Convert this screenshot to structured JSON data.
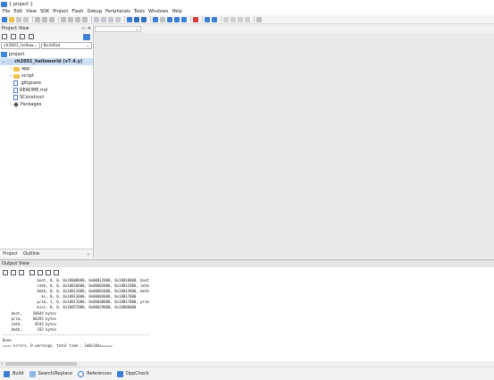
{
  "window": {
    "title": "{ project }"
  },
  "menubar": [
    "File",
    "Edit",
    "View",
    "SDK",
    "Project",
    "Flash",
    "Debug",
    "Peripherals",
    "Tools",
    "Windows",
    "Help"
  ],
  "colors": {
    "accent": "#3f83d6",
    "folder": "#f0c24a",
    "selection": "#cce0f7"
  },
  "project_view": {
    "title": "Project View",
    "header_controls": [
      "pin-icon",
      "close-icon"
    ],
    "toolbar_icons": [
      "navigate-icon",
      "home-icon",
      "settings-icon",
      "target-icon",
      "link-icon"
    ],
    "target_combo": "ch2601_hellow",
    "build_combo": "BuildSet",
    "tree": [
      {
        "label": "project",
        "icon": "project-icon",
        "indent": 0,
        "arrow": ""
      },
      {
        "label": "ch2601_helloworld (v7.4.y)",
        "icon": "folder-icon",
        "indent": 1,
        "arrow": "⌄",
        "selected": true
      },
      {
        "label": "app",
        "icon": "folder-icon",
        "indent": 2,
        "arrow": "›"
      },
      {
        "label": "script",
        "icon": "folder-icon",
        "indent": 2,
        "arrow": "›"
      },
      {
        "label": ".gitignore",
        "icon": "file-icon",
        "indent": 2,
        "arrow": ""
      },
      {
        "label": "README.md",
        "icon": "file-icon",
        "indent": 2,
        "arrow": ""
      },
      {
        "label": "SConstruct",
        "icon": "file-icon",
        "indent": 2,
        "arrow": ""
      },
      {
        "label": "Packages",
        "icon": "package-icon",
        "indent": 2,
        "arrow": "›"
      }
    ],
    "bottom_tabs": [
      "Project",
      "Outline"
    ]
  },
  "output_view": {
    "title": "Output View",
    "console_lines": [
      "                boot, 0, 0, 0x18000000, 0x00012000, 0x18010000, boot",
      "                imtb, 0, 0, 0x18010000, 0x00002000, 0x18012000, imtb",
      "                bmtb, 0, 0, 0x18012000, 0x00001000, 0x18013000, bmtb",
      "                  kv, 0, 0, 0x18013000, 0x00004000, 0x18017000",
      "                prim, 1, 0, 0x18017000, 0x00040000, 0x18057000, prim",
      "                misc, 0, 0, 0x18057000, 0x00029000, 0x18080000",
      "    boot,     58644 bytes",
      "    prim,     66392 bytes",
      "    imtb,      8192 bytes",
      "    bmtb,       192 bytes",
      "--------------------------------------------------------------------",
      "Done",
      "==== errors, 0 warnings, total time : 1m0s10ms====="
    ]
  },
  "statusbar": [
    "Build",
    "Search/Replace",
    "References",
    "OppCheck"
  ]
}
